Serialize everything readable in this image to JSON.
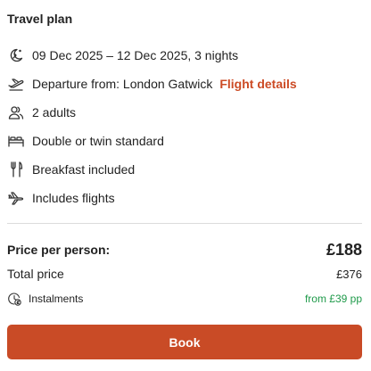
{
  "travel_plan": {
    "title": "Travel plan",
    "items": [
      {
        "icon": "calendar-moon-icon",
        "text": "09 Dec 2025 – 12 Dec 2025, 3 nights"
      },
      {
        "icon": "plane-departure-icon",
        "text": "Departure from: London Gatwick",
        "link": "Flight details"
      },
      {
        "icon": "people-icon",
        "text": "2 adults"
      },
      {
        "icon": "bed-icon",
        "text": "Double or twin standard"
      },
      {
        "icon": "fork-knife-icon",
        "text": "Breakfast included"
      },
      {
        "icon": "plane-icon",
        "text": "Includes flights"
      }
    ]
  },
  "pricing": {
    "per_person_label": "Price per person:",
    "per_person_value": "£188",
    "total_label": "Total price",
    "total_value": "£376",
    "instalments_label": "Instalments",
    "instalments_value": "from £39 pp",
    "instalments_icon": "clock-pound-icon"
  },
  "actions": {
    "book_label": "Book"
  },
  "colors": {
    "accent": "#c94b26",
    "link": "#cc4b25",
    "instalment_green": "#1f9a4a",
    "text": "#222222",
    "divider": "#dcdcdc"
  }
}
